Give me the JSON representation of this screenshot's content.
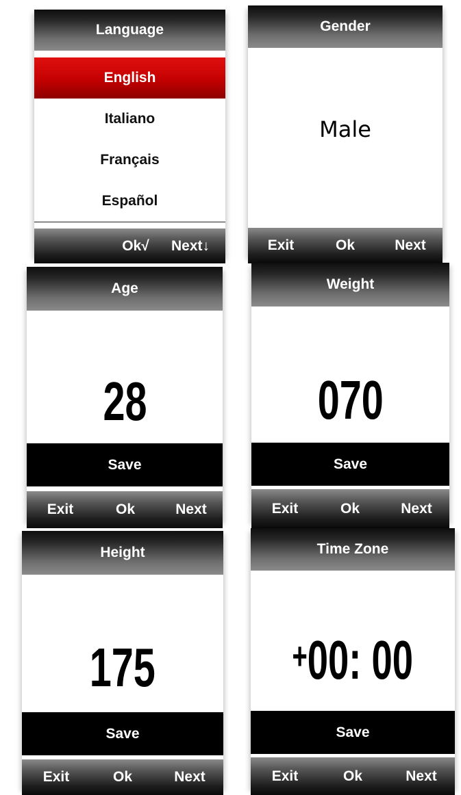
{
  "language": {
    "title": "Language",
    "items": [
      "English",
      "Italiano",
      "Français",
      "Español"
    ],
    "ok": "Ok√",
    "next": "Next↓"
  },
  "gender": {
    "title": "Gender",
    "value": "Male",
    "exit": "Exit",
    "ok": "Ok",
    "next": "Next"
  },
  "age": {
    "title": "Age",
    "value": "28",
    "save": "Save",
    "exit": "Exit",
    "ok": "Ok",
    "next": "Next"
  },
  "weight": {
    "title": "Weight",
    "value": "070",
    "save": "Save",
    "exit": "Exit",
    "ok": "Ok",
    "next": "Next"
  },
  "height": {
    "title": "Height",
    "value": "175",
    "save": "Save",
    "exit": "Exit",
    "ok": "Ok",
    "next": "Next"
  },
  "timezone": {
    "title": "Time Zone",
    "sign": "+",
    "value": "00: 00",
    "save": "Save",
    "exit": "Exit",
    "ok": "Ok",
    "next": "Next"
  }
}
